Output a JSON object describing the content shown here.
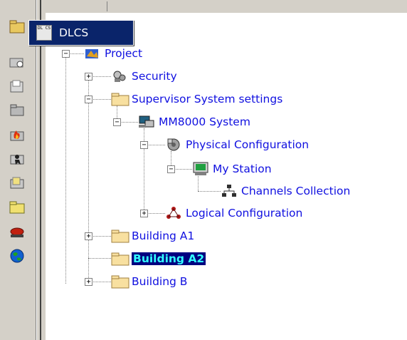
{
  "popup": {
    "label": "DLCS",
    "icon_text": "DL CS"
  },
  "toolbar": {
    "buttons": [
      "folder-open-icon",
      "folder-search-icon",
      "folder-page-icon",
      "folder-gray-icon",
      "folder-fire-icon",
      "folder-intrusion-icon",
      "folder-list-icon",
      "folder-yellow-icon",
      "alarm-light-icon",
      "globe-icon"
    ]
  },
  "tree": {
    "project": "Project",
    "security": "Security",
    "supervisor": "Supervisor System settings",
    "mm8000": "MM8000 System",
    "physical": "Physical Configuration",
    "mystation": "My Station",
    "channels": "Channels Collection",
    "logical": "Logical Configuration",
    "buildingA1": "Building A1",
    "buildingA2": "Building A2",
    "buildingB": "Building B"
  },
  "colors": {
    "link": "#1010e0",
    "selection_bg": "#000080",
    "selection_text": "#33ffff",
    "chrome": "#d4d0c8"
  }
}
